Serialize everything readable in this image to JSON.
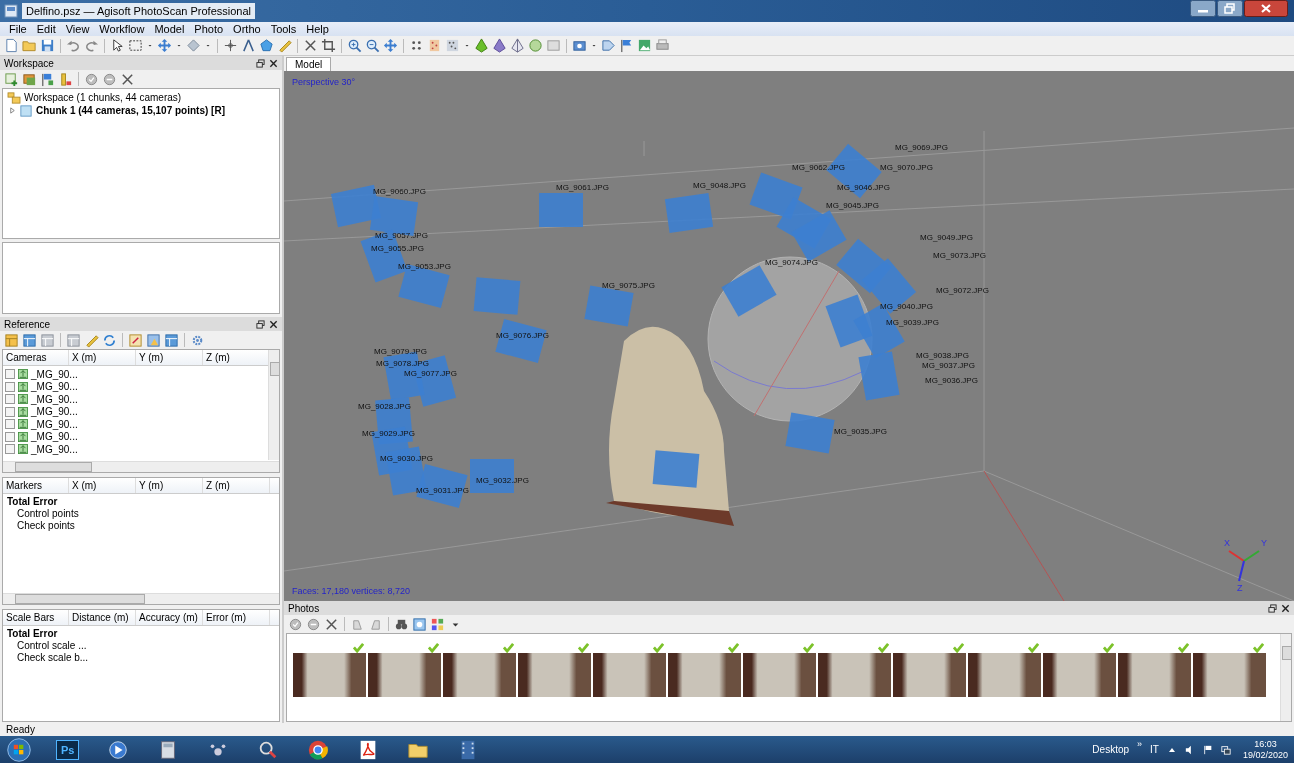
{
  "window": {
    "title": "Delfino.psz — Agisoft PhotoScan Professional"
  },
  "menu": [
    "File",
    "Edit",
    "View",
    "Workflow",
    "Model",
    "Photo",
    "Ortho",
    "Tools",
    "Help"
  ],
  "workspace": {
    "title": "Workspace",
    "tree": [
      {
        "label": "Workspace (1 chunks, 44 cameras)",
        "children": [
          {
            "label": "Chunk 1 (44 cameras, 15,107 points) [R]",
            "expanded": false
          }
        ]
      }
    ]
  },
  "reference": {
    "title": "Reference",
    "cameras": {
      "columns": [
        "Cameras",
        "X (m)",
        "Y (m)",
        "Z (m)"
      ],
      "rows": [
        {
          "label": "_MG_90...",
          "checked": false
        },
        {
          "label": "_MG_90...",
          "checked": false
        },
        {
          "label": "_MG_90...",
          "checked": false
        },
        {
          "label": "_MG_90...",
          "checked": false
        },
        {
          "label": "_MG_90...",
          "checked": false
        },
        {
          "label": "_MG_90...",
          "checked": false
        },
        {
          "label": "_MG_90...",
          "checked": false
        }
      ]
    },
    "markers": {
      "columns": [
        "Markers",
        "X (m)",
        "Y (m)",
        "Z (m)"
      ],
      "rows": [
        {
          "label": "Total Error",
          "kind": "total"
        },
        {
          "label": "Control points",
          "kind": "item"
        },
        {
          "label": "Check points",
          "kind": "item"
        }
      ]
    },
    "scale_bars": {
      "columns": [
        "Scale Bars",
        "Distance (m)",
        "Accuracy (m)",
        "Error (m)"
      ],
      "rows": [
        {
          "label": "Total Error",
          "kind": "total"
        },
        {
          "label": "Control scale ...",
          "kind": "item"
        },
        {
          "label": "Check scale b...",
          "kind": "item"
        }
      ]
    }
  },
  "model": {
    "tabs": [
      {
        "label": "Model",
        "selected": true
      }
    ],
    "projection": "Perspective 30°",
    "stats": "Faces: 17,180 vertices: 8,720",
    "camera_labels": [
      "MG_9060.JPG",
      "MG_9061.JPG",
      "MG_9048.JPG",
      "MG_9062.JPG",
      "MG_9069.JPG",
      "MG_9070.JPG",
      "MG_9046.JPG",
      "MG_9045.JPG",
      "MG_9057.JPG",
      "MG_9055.JPG",
      "MG_9053.JPG",
      "MG_9049.JPG",
      "MG_9073.JPG",
      "MG_9074.JPG",
      "MG_9075.JPG",
      "MG_9072.JPG",
      "MG_9040.JPG",
      "MG_9039.JPG",
      "MG_9076.JPG",
      "MG_9079.JPG",
      "MG_9078.JPG",
      "MG_9077.JPG",
      "MG_9038.JPG",
      "MG_9037.JPG",
      "MG_9036.JPG",
      "MG_9028.JPG",
      "MG_9029.JPG",
      "MG_9035.JPG",
      "MG_9030.JPG",
      "MG_9032.JPG",
      "MG_9031.JPG"
    ],
    "axes": [
      "X",
      "Y",
      "Z"
    ]
  },
  "photos": {
    "title": "Photos",
    "items": [
      {
        "aligned": true
      },
      {
        "aligned": true
      },
      {
        "aligned": true
      },
      {
        "aligned": true
      },
      {
        "aligned": true
      },
      {
        "aligned": true
      },
      {
        "aligned": true
      },
      {
        "aligned": true
      },
      {
        "aligned": true
      },
      {
        "aligned": true
      },
      {
        "aligned": true
      },
      {
        "aligned": true
      },
      {
        "aligned": true
      }
    ]
  },
  "status_bar": "Ready",
  "taskbar": {
    "ps_label": "Ps",
    "desktop": "Desktop",
    "overflow": "»",
    "language": "IT",
    "time": "16:03",
    "date": "19/02/2020"
  }
}
